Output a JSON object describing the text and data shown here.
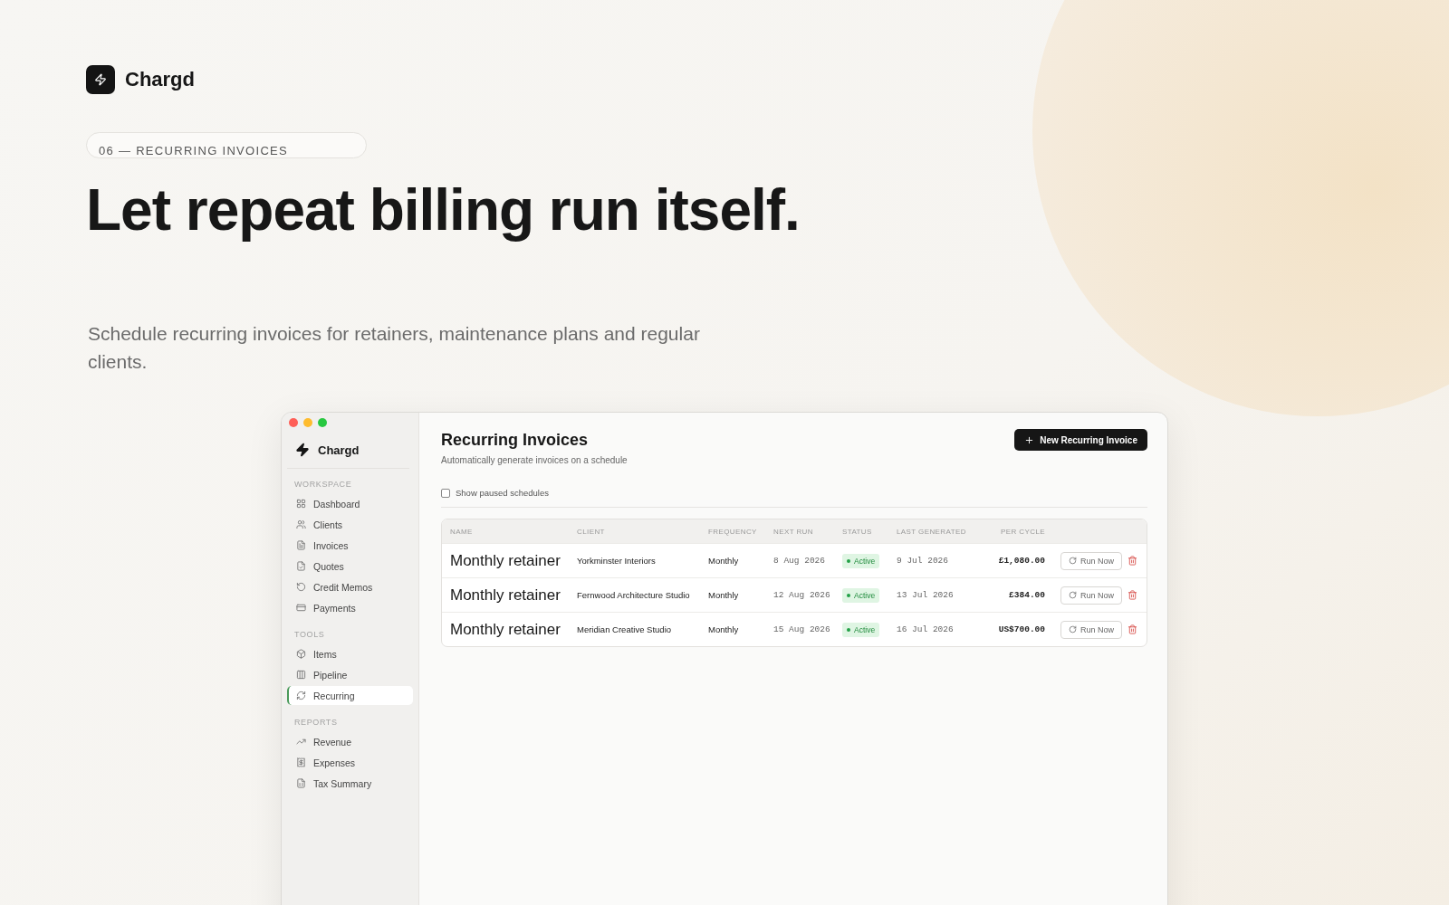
{
  "brand": {
    "name": "Chargd"
  },
  "section_pill": "06 — RECURRING INVOICES",
  "headline": "Let repeat billing run itself.",
  "subtitle": "Schedule recurring invoices for retainers, maintenance plans and regular clients.",
  "app": {
    "sidebar": {
      "brand": "Chargd",
      "sections": [
        {
          "title": "WORKSPACE",
          "items": [
            {
              "label": "Dashboard",
              "selected": false
            },
            {
              "label": "Clients",
              "selected": false
            },
            {
              "label": "Invoices",
              "selected": false
            },
            {
              "label": "Quotes",
              "selected": false
            },
            {
              "label": "Credit Memos",
              "selected": false
            },
            {
              "label": "Payments",
              "selected": false
            }
          ]
        },
        {
          "title": "TOOLS",
          "items": [
            {
              "label": "Items",
              "selected": false
            },
            {
              "label": "Pipeline",
              "selected": false
            },
            {
              "label": "Recurring",
              "selected": true
            }
          ]
        },
        {
          "title": "REPORTS",
          "items": [
            {
              "label": "Revenue",
              "selected": false
            },
            {
              "label": "Expenses",
              "selected": false
            },
            {
              "label": "Tax Summary",
              "selected": false
            }
          ]
        }
      ]
    },
    "page": {
      "title": "Recurring Invoices",
      "subtitle": "Automatically generate invoices on a schedule",
      "new_button": "New Recurring Invoice",
      "filter": {
        "label": "Show paused schedules",
        "checked": false
      },
      "table": {
        "columns": [
          "NAME",
          "CLIENT",
          "FREQUENCY",
          "NEXT RUN",
          "STATUS",
          "LAST GENERATED",
          "PER CYCLE"
        ],
        "rows": [
          {
            "name": "Monthly retainer",
            "client": "Yorkminster Interiors",
            "frequency": "Monthly",
            "next_run": "8 Aug 2026",
            "status": "Active",
            "last_generated": "9 Jul 2026",
            "per_cycle": "£1,080.00",
            "action": "Run Now"
          },
          {
            "name": "Monthly retainer",
            "client": "Fernwood Architecture Studio",
            "frequency": "Monthly",
            "next_run": "12 Aug 2026",
            "status": "Active",
            "last_generated": "13 Jul 2026",
            "per_cycle": "£384.00",
            "action": "Run Now"
          },
          {
            "name": "Monthly retainer",
            "client": "Meridian Creative Studio",
            "frequency": "Monthly",
            "next_run": "15 Aug 2026",
            "status": "Active",
            "last_generated": "16 Jul 2026",
            "per_cycle": "US$700.00",
            "action": "Run Now"
          }
        ]
      }
    }
  }
}
